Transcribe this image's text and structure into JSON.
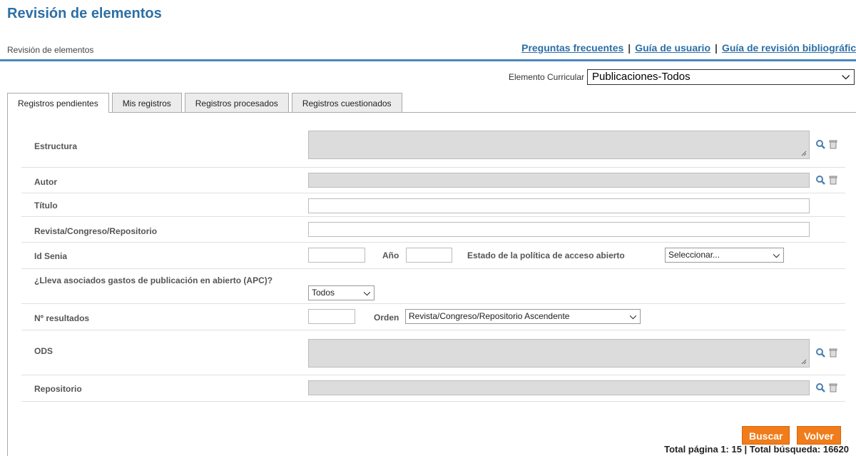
{
  "page": {
    "title": "Revisión de elementos"
  },
  "breadcrumb": "Revisión de elementos",
  "header_links": [
    "Preguntas frecuentes",
    "Guía de usuario",
    "Guía de revisión bibliográfica"
  ],
  "curricular": {
    "label": "Elemento Curricular",
    "value": "Publicaciones-Todos"
  },
  "tabs": [
    "Registros pendientes",
    "Mis registros",
    "Registros procesados",
    "Registros cuestionados"
  ],
  "form": {
    "estructura": "Estructura",
    "autor": "Autor",
    "titulo": "Título",
    "revista": "Revista/Congreso/Repositorio",
    "id_senia": "Id Senia",
    "anio": "Año",
    "estado_politica": "Estado de la política de acceso abierto",
    "estado_politica_value": "Seleccionar...",
    "apc": "¿Lleva asociados gastos de publicación en abierto (APC)?",
    "apc_value": "Todos",
    "n_resultados": "Nº resultados",
    "orden": "Orden",
    "orden_value": "Revista/Congreso/Repositorio Ascendente",
    "ods": "ODS",
    "repositorio": "Repositorio"
  },
  "buttons": {
    "buscar": "Buscar",
    "volver": "Volver"
  },
  "totals": "Total página 1: 15 | Total búsqueda: 16620",
  "icons": {
    "search": "magnifier-icon",
    "delete": "trash-icon"
  },
  "colors": {
    "accent": "#2c6fa6",
    "button": "#f07c1a"
  }
}
